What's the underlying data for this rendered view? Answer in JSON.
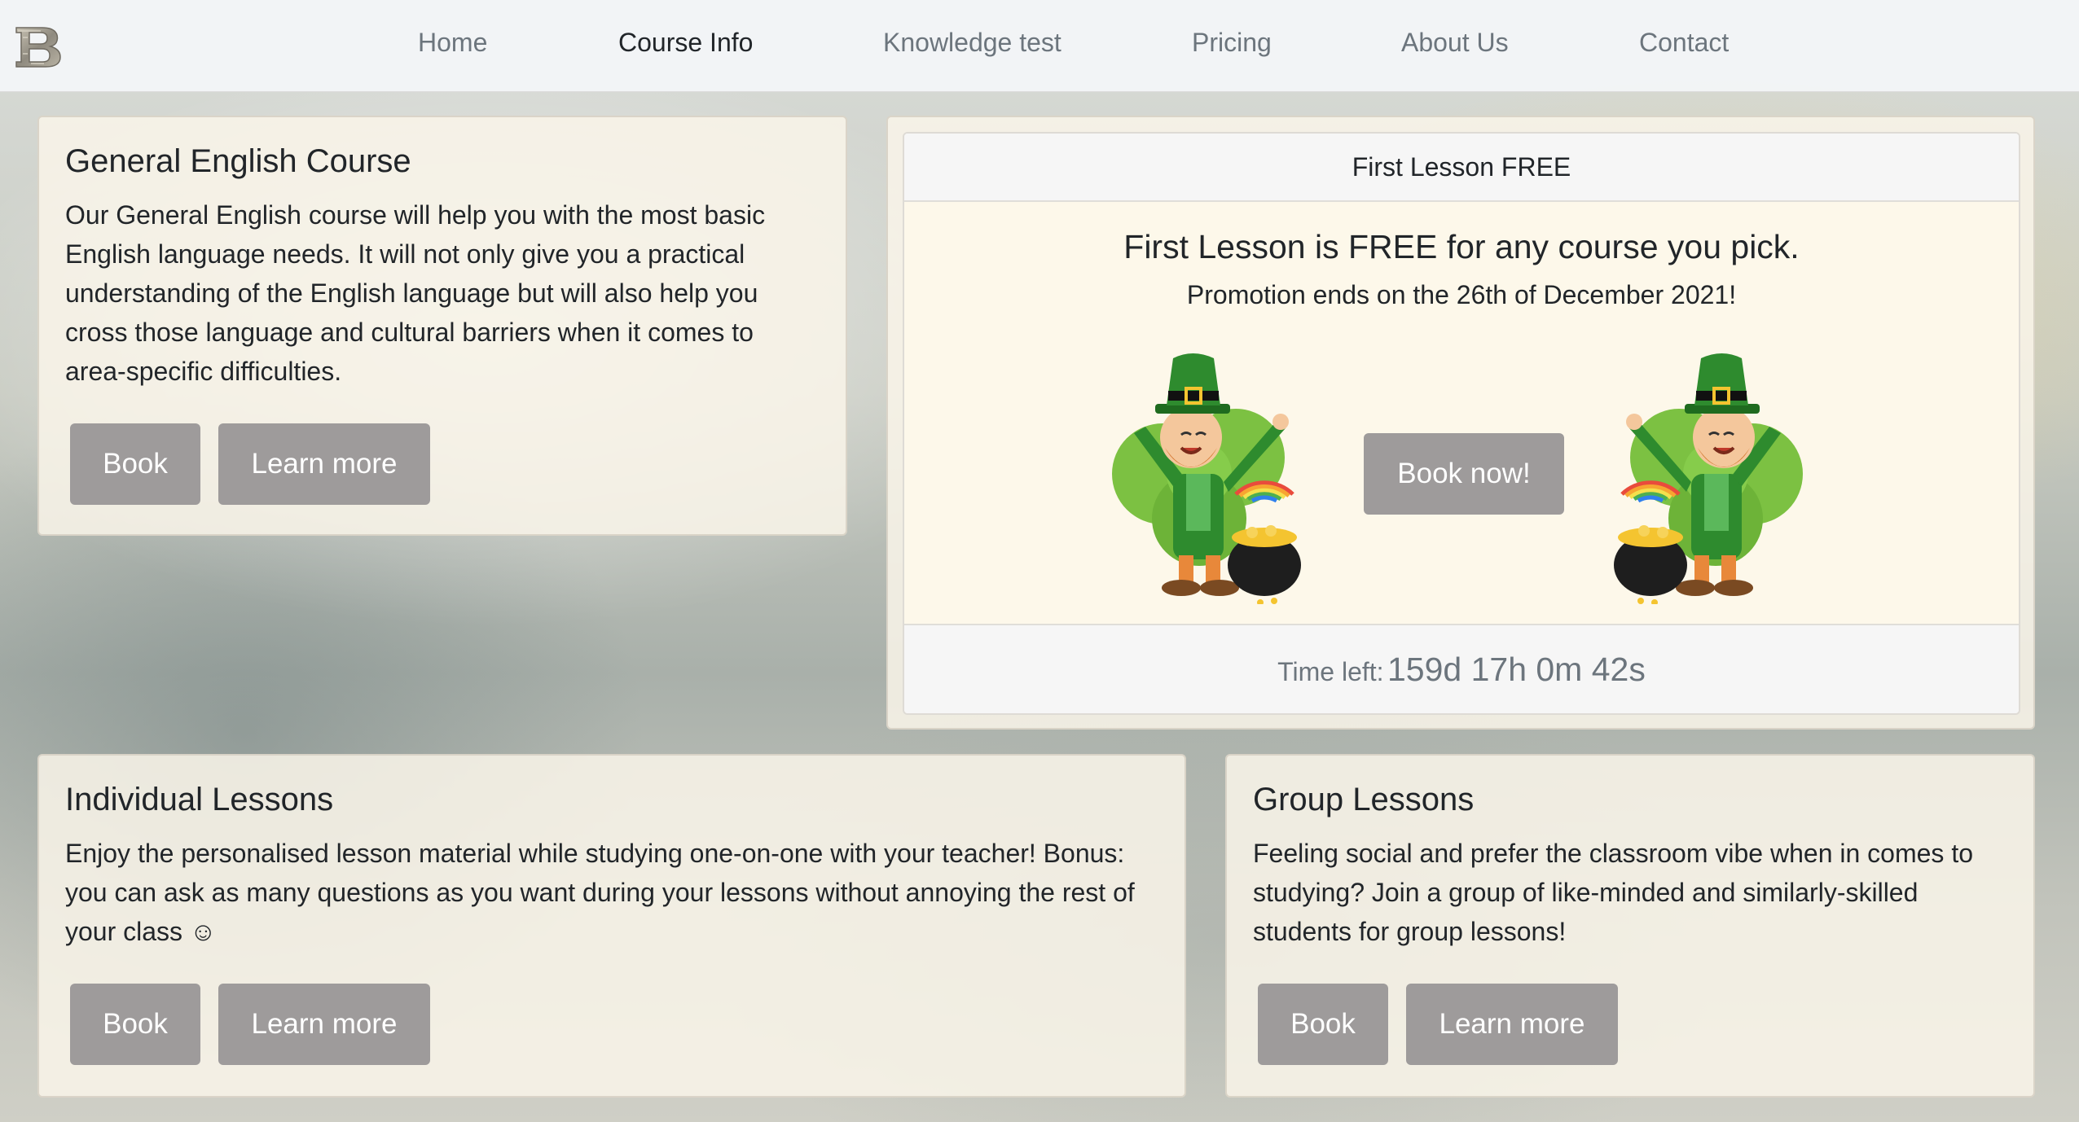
{
  "nav": {
    "brand_icon": "brand-logo-B",
    "items": [
      {
        "label": "Home",
        "active": false
      },
      {
        "label": "Course Info",
        "active": true
      },
      {
        "label": "Knowledge test",
        "active": false
      },
      {
        "label": "Pricing",
        "active": false
      },
      {
        "label": "About Us",
        "active": false
      },
      {
        "label": "Contact",
        "active": false
      }
    ]
  },
  "courses": {
    "general": {
      "title": "General English Course",
      "text_lines": [
        "Our General English course will help you with the most basic",
        "English language needs. It will not only give you a practical",
        "understanding of the English language but will also help you",
        "cross those language and cultural barriers when it comes to",
        "area-specific difficulties."
      ],
      "book_label": "Book",
      "learn_label": "Learn more"
    },
    "individual": {
      "title": "Individual Lessons",
      "text_lines": [
        "Enjoy the personalised lesson material while studying one-on-one with your teacher! Bonus:",
        "you can ask as many questions as you want during your lessons without annoying the rest of",
        "your class ☺"
      ],
      "book_label": "Book",
      "learn_label": "Learn more"
    },
    "group": {
      "title": "Group Lessons",
      "text_lines": [
        "Feeling social and prefer the classroom vibe when in comes to",
        "studying? Join a group of like-minded and similarly-skilled",
        "students for group lessons!"
      ],
      "book_label": "Book",
      "learn_label": "Learn more"
    }
  },
  "promo": {
    "header": "First Lesson FREE",
    "headline": "First Lesson is FREE for any course you pick.",
    "subtext": "Promotion ends on the 26th of December 2021!",
    "button_label": "Book now!",
    "time_label": "Time left:",
    "time_value": "159d 17h 0m 42s",
    "image_icon": "leprechaun-dab-illustration"
  },
  "colors": {
    "button_bg": "#9e9b9b",
    "card_bg": "#f9f4e9",
    "nav_active": "#212529",
    "nav_inactive": "#6c757d",
    "leprechaun_green": "#2e8b2e",
    "shamrock_green": "#7cc142"
  }
}
